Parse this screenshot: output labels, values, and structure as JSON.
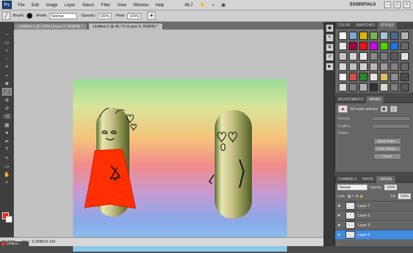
{
  "app": {
    "logo": "Ps",
    "menu": [
      "File",
      "Edit",
      "Image",
      "Layer",
      "Select",
      "Filter",
      "View",
      "Window",
      "Help"
    ],
    "zoom_readout": "66.7",
    "workspace": "ESSENTIALS",
    "window_buttons": [
      "–",
      "□",
      "×"
    ]
  },
  "options": {
    "brush_label": "Brush:",
    "mode_label": "Mode:",
    "mode_value": "Normal",
    "opacity_label": "Opacity:",
    "opacity_value": "100%",
    "flow_label": "Flow:",
    "flow_value": "100%"
  },
  "documents": {
    "tabs": [
      "Untitled-1 @ 100% (Layer 2, RGB/8) *",
      "Untitled-2 @ 66.7% (Layer 6, RGB/8) *"
    ],
    "active_index": 1
  },
  "tools": {
    "items": [
      "move",
      "marquee",
      "lasso",
      "quick-select",
      "crop",
      "eyedropper",
      "healing",
      "brush",
      "stamp",
      "history",
      "eraser",
      "gradient",
      "dodge",
      "pen",
      "type",
      "path-select",
      "shape",
      "hand",
      "zoom"
    ],
    "glyphs": [
      "↔",
      "▭",
      "ʟ",
      "◌",
      "⌗",
      "⌁",
      "✚",
      "╱",
      "✣",
      "↺",
      "⌫",
      "▦",
      "●",
      "✒",
      "T",
      "↖",
      "▭",
      "✋",
      "⌕"
    ],
    "active_index": 7,
    "foreground_color": "#ff2200",
    "background_color": "#ffffff"
  },
  "status": {
    "zoom": "66.67%",
    "doc": "Doc: 2.29M/10.1M",
    "taskbar": "Untitled-..."
  },
  "panels": {
    "styles_tabs": [
      "COLOR",
      "SWATCHES",
      "STYLES"
    ],
    "styles_active": 2,
    "style_swatches": [
      "#f4f4f4",
      "#7fa6ce",
      "#d9b600",
      "#7cae54",
      "#a6c1d8",
      "#4b6b8c",
      "#b1b1b1",
      "#e9e9e9",
      "#a7003f",
      "#f20f0f",
      "#c60ae8",
      "#54d400",
      "#1d77e8",
      "#6a6a6a",
      "#c4c4c4",
      "#d2d2d2",
      "#e8e8e8",
      "#888888",
      "#7c7c7c",
      "#5a5a5a",
      "#e0e0e0",
      "#d9d9d9",
      "#bdbdbd",
      "#d1d1d1",
      "#b7b7b7",
      "#9c9c9c",
      "#808080",
      "#6a6a6a",
      "#f7f7f7",
      "#d74d4d",
      "#2a8a2a",
      "#e5e5e5",
      "#e0bb5c",
      "#8f8f8f",
      "#4d4d4d",
      "#dcdcdc",
      "#7f7f7f",
      "#b0b0b0",
      "#333333",
      "#d9d9d9",
      "#7f7f7f",
      "#595959"
    ],
    "adjust_tabs": [
      "ADJUSTMENTS",
      "MASKS"
    ],
    "adjust_active": 1,
    "mask_message": "No mask selected",
    "mask_labels": [
      "Density:",
      "Feather:",
      "Refine:"
    ],
    "mask_buttons": [
      "Mask Edge...",
      "Color Range...",
      "Invert"
    ],
    "layers_tabs": [
      "CHANNELS",
      "PATHS",
      "LAYERS"
    ],
    "layers_active": 2,
    "blend_mode": "Normal",
    "opacity_label": "Opacity:",
    "opacity_value": "100%",
    "lock_label": "Lock:",
    "fill_label": "Fill:",
    "fill_value": "100%",
    "layers": [
      "Layer 7",
      "Layer 5",
      "Layer 3",
      "Layer 6"
    ],
    "selected_layer": "Layer 6"
  },
  "icons": {
    "panel_column": [
      "palette-icon",
      "brush-preset-icon",
      "clone-source-icon",
      "history-icon",
      "actions-icon"
    ],
    "options_toggle": "airbrush-icon"
  }
}
